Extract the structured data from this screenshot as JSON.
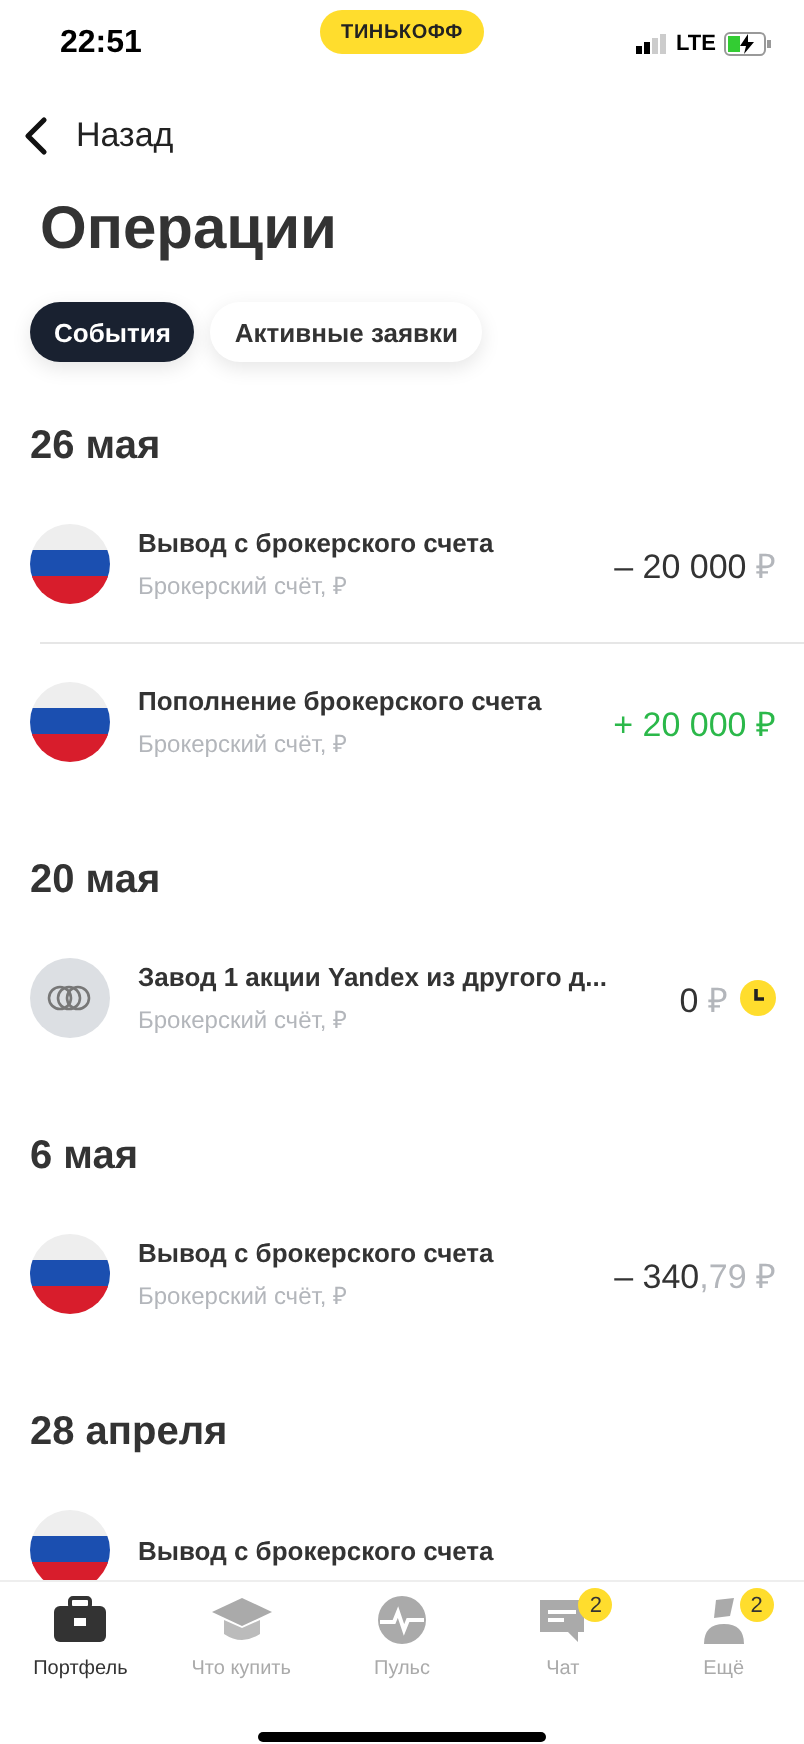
{
  "status_bar": {
    "time": "22:51",
    "brand": "ТИНЬКОФФ",
    "network": "LTE"
  },
  "back": {
    "label": "Назад"
  },
  "title": "Операции",
  "filters": [
    {
      "label": "События",
      "selected": true
    },
    {
      "label": "Активные заявки",
      "selected": false
    }
  ],
  "sections": [
    {
      "date": "26 мая",
      "operations": [
        {
          "kind": "flag",
          "title": "Вывод с брокерского счета",
          "account": "Брокерский счёт, ₽",
          "positive": false,
          "amount": "– 20 000",
          "amount_minor": " ₽",
          "pending": false
        },
        {
          "kind": "flag",
          "title": "Пополнение брокерского счета",
          "account": "Брокерский счёт, ₽",
          "positive": true,
          "amount": "+ 20 000",
          "amount_minor": " ₽",
          "pending": false
        }
      ]
    },
    {
      "date": "20 мая",
      "operations": [
        {
          "kind": "shares",
          "title": "Завод 1 акции Yandex из другого д...",
          "account": "Брокерский счёт, ₽",
          "positive": false,
          "amount": "0",
          "amount_minor": " ₽",
          "pending": true
        }
      ]
    },
    {
      "date": "6 мая",
      "operations": [
        {
          "kind": "flag",
          "title": "Вывод с брокерского счета",
          "account": "Брокерский счёт, ₽",
          "positive": false,
          "amount": "– 340",
          "amount_minor": ",79 ₽",
          "pending": false
        }
      ]
    },
    {
      "date": "28 апреля",
      "operations": [
        {
          "kind": "flag",
          "title": "Вывод с брокерского счета"
        }
      ]
    }
  ],
  "tab_bar": [
    {
      "kind": "portfolio",
      "label": "Портфель",
      "selected": true
    },
    {
      "kind": "learn",
      "label": "Что купить",
      "selected": false
    },
    {
      "kind": "pulse",
      "label": "Пульс",
      "selected": false
    },
    {
      "kind": "chat",
      "label": "Чат",
      "selected": false,
      "badge": "2"
    },
    {
      "kind": "more",
      "label": "Ещё",
      "selected": false,
      "badge": "2"
    }
  ]
}
